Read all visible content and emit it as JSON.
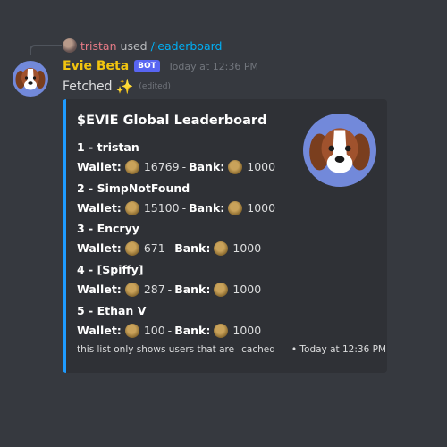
{
  "reply": {
    "username": "tristan",
    "used_text": "used",
    "command": "/leaderboard"
  },
  "message": {
    "author": "Evie Beta",
    "bot_tag": "BOT",
    "timestamp": "Today at 12:36 PM",
    "content": "Fetched",
    "emoji": "✨",
    "edited": "(edited)"
  },
  "embed": {
    "accent_color": "#1e9bff",
    "title": "$EVIE Global Leaderboard",
    "wallet_label": "Wallet:",
    "bank_label": "Bank:",
    "separator": "-",
    "entries": [
      {
        "rank": "1 - tristan",
        "wallet": "16769",
        "bank": "1000"
      },
      {
        "rank": "2 - SimpNotFound",
        "wallet": "15100",
        "bank": "1000"
      },
      {
        "rank": "3 - Encryy",
        "wallet": "671",
        "bank": "1000"
      },
      {
        "rank": "4 - [Spiffy]",
        "wallet": "287",
        "bank": "1000"
      },
      {
        "rank": "5 - Ethan V",
        "wallet": "100",
        "bank": "1000"
      }
    ],
    "footer_text_a": "this list only shows users that are",
    "footer_text_b": "cached",
    "footer_time": "• Today at 12:36 PM"
  },
  "icons": [
    "dog-avatar-icon",
    "coin-icon",
    "sparkles-icon"
  ]
}
